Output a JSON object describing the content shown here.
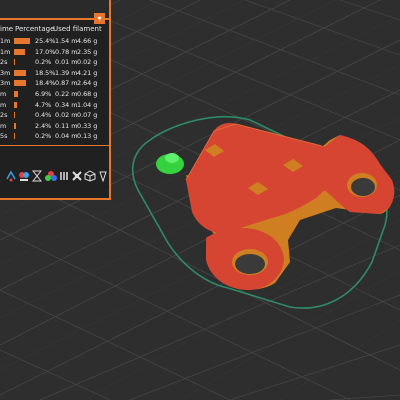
{
  "legend": {
    "columns": [
      "Time",
      "Percentage",
      "Used filament"
    ],
    "column_visible": [
      "ime",
      "Percentage",
      "Used filament"
    ],
    "rows": [
      {
        "time": "1m",
        "percent": "25.4%",
        "length": "1.54 m",
        "weight": "4.66 g",
        "fraction": 0.254
      },
      {
        "time": "1m",
        "percent": "17.0%",
        "length": "0.78 m",
        "weight": "2.35 g",
        "fraction": 0.17
      },
      {
        "time": "2s",
        "percent": "0.2%",
        "length": "0.01 m",
        "weight": "0.02 g",
        "fraction": 0.002
      },
      {
        "time": "3m",
        "percent": "18.5%",
        "length": "1.39 m",
        "weight": "4.21 g",
        "fraction": 0.185
      },
      {
        "time": "3m",
        "percent": "18.4%",
        "length": "0.87 m",
        "weight": "2.64 g",
        "fraction": 0.184
      },
      {
        "time": "m",
        "percent": "6.9%",
        "length": "0.22 m",
        "weight": "0.68 g",
        "fraction": 0.069
      },
      {
        "time": "m",
        "percent": "4.7%",
        "length": "0.34 m",
        "weight": "1.04 g",
        "fraction": 0.047
      },
      {
        "time": "2s",
        "percent": "0.4%",
        "length": "0.02 m",
        "weight": "0.07 g",
        "fraction": 0.004
      },
      {
        "time": "m",
        "percent": "2.4%",
        "length": "0.11 m",
        "weight": "0.33 g",
        "fraction": 0.024
      },
      {
        "time": "5s",
        "percent": "0.2%",
        "length": "0.04 m",
        "weight": "0.13 g",
        "fraction": 0.002
      }
    ],
    "dropdown_icon": "chevron-down-icon"
  },
  "toolbar": {
    "icons": [
      "travel-icon",
      "wipe-icon",
      "retraction-icon",
      "color-change-icon",
      "pause-icon",
      "custom-gcode-icon",
      "shells-icon",
      "tool-marker-icon"
    ]
  },
  "colors": {
    "accent": "#e8772e",
    "panel": "#202020",
    "background": "#2e2e2e",
    "grid": "#3f3f3f",
    "part_top": "#d64532",
    "part_wall": "#d28222",
    "skirt": "#2f8a68",
    "marker": "#34d23f"
  }
}
